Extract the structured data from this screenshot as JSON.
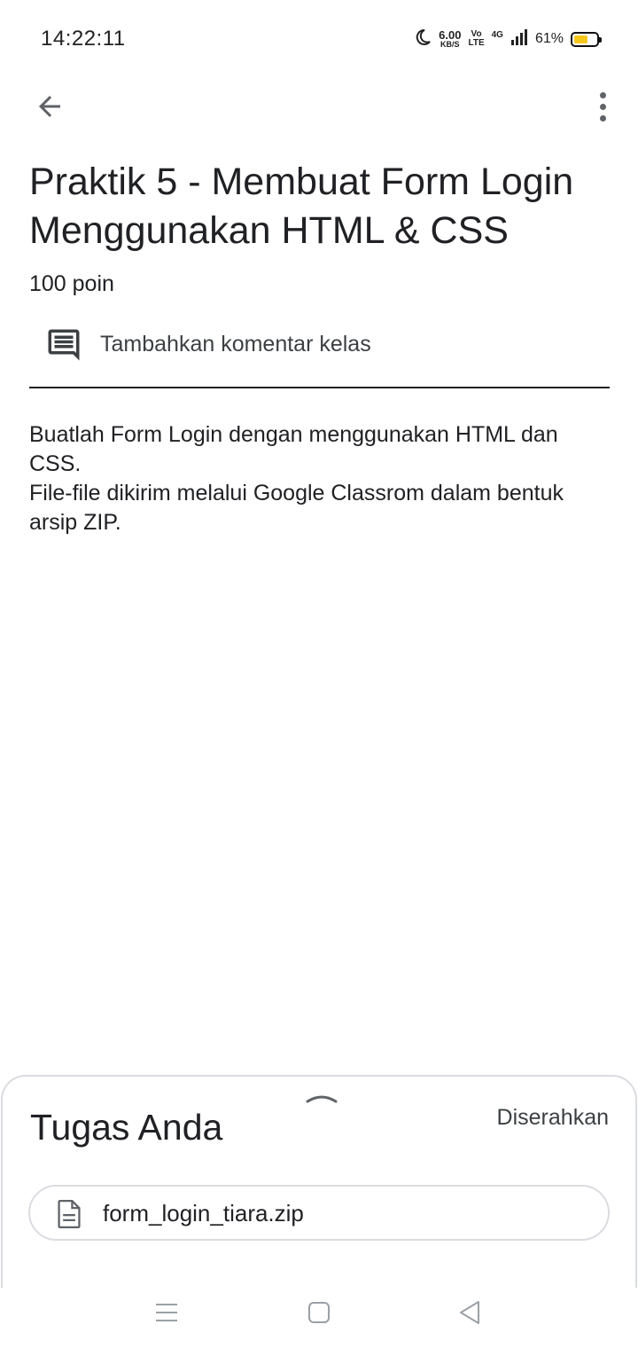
{
  "status_bar": {
    "time": "14:22:11",
    "speed_value": "6.00",
    "speed_unit": "KB/S",
    "volte_top": "Vo",
    "volte_bottom": "LTE",
    "network": "4G",
    "battery_percent": "61%",
    "battery_level": 0.61,
    "battery_color": "#f6c71b"
  },
  "app_bar": {
    "back_icon": "arrow-back-icon",
    "more_icon": "more-vert-icon"
  },
  "assignment": {
    "title": "Praktik 5 - Membuat Form Login Menggunakan HTML & CSS",
    "points": "100 poin",
    "comment_label": "Tambahkan komentar kelas",
    "comment_icon": "comment-icon",
    "description": [
      "Buatlah Form Login dengan menggunakan HTML dan CSS.",
      "File-file dikirim melalui Google Classrom dalam bentuk arsip ZIP."
    ]
  },
  "your_work": {
    "title": "Tugas Anda",
    "status": "Diserahkan",
    "handle_icon": "chevron-up-icon",
    "attachment": {
      "icon": "document-icon",
      "file_name": "form_login_tiara.zip"
    }
  },
  "nav_bar": {
    "menu_icon": "menu-icon",
    "home_icon": "home-square-icon",
    "back_icon": "back-triangle-icon"
  }
}
